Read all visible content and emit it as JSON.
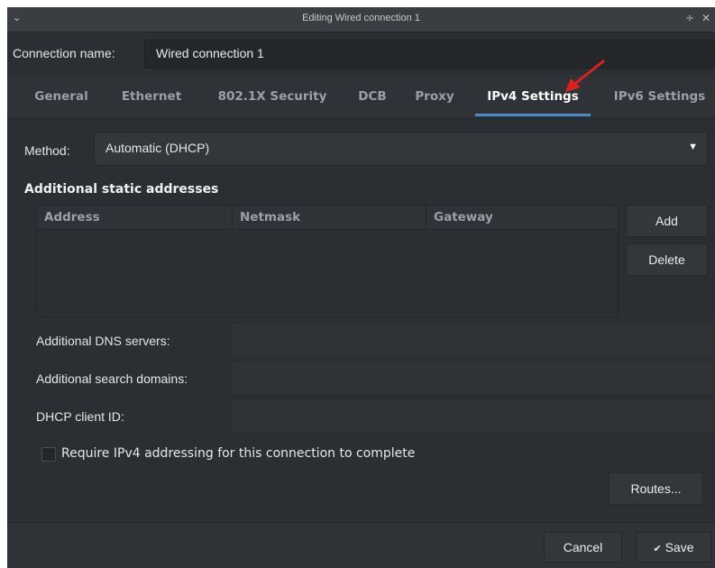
{
  "window": {
    "title": "Editing Wired connection 1",
    "menu_glyph": "⌄",
    "restore_glyph": "÷",
    "close_glyph": "✕"
  },
  "connection": {
    "name_label": "Connection name:",
    "name_value": "Wired connection 1"
  },
  "tabs": [
    {
      "label": "General",
      "active": false
    },
    {
      "label": "Ethernet",
      "active": false
    },
    {
      "label": "802.1X Security",
      "active": false
    },
    {
      "label": "DCB",
      "active": false
    },
    {
      "label": "Proxy",
      "active": false
    },
    {
      "label": "IPv4 Settings",
      "active": true
    },
    {
      "label": "IPv6 Settings",
      "active": false
    }
  ],
  "ipv4": {
    "method_label": "Method:",
    "method_value": "Automatic (DHCP)",
    "static_heading": "Additional static addresses",
    "columns": [
      "Address",
      "Netmask",
      "Gateway"
    ],
    "rows": [],
    "add_label": "Add",
    "delete_label": "Delete",
    "dns_label": "Additional DNS servers:",
    "dns_value": "",
    "search_label": "Additional search domains:",
    "search_value": "",
    "dhcp_label": "DHCP client ID:",
    "dhcp_value": "",
    "require_label": "Require IPv4 addressing for this connection to complete",
    "require_checked": false,
    "routes_label": "Routes..."
  },
  "footer": {
    "cancel_label": "Cancel",
    "save_label": "Save",
    "save_icon": "✔"
  },
  "colors": {
    "background": "#2b2f33",
    "accent": "#4d89c9",
    "annotation_arrow": "#e02020"
  }
}
